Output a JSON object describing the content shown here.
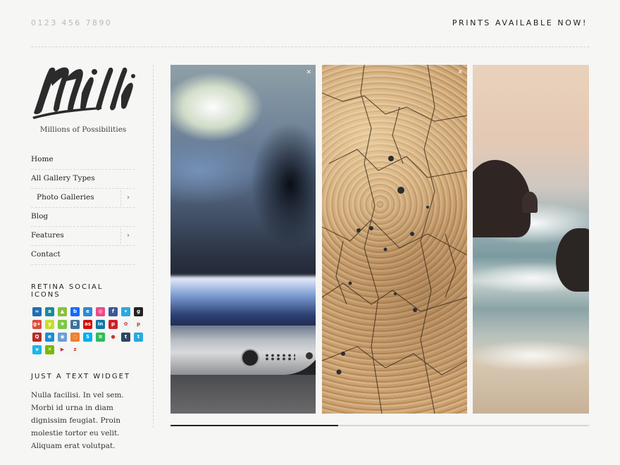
{
  "header": {
    "phone": "0123 456 7890",
    "promo": "PRINTS AVAILABLE NOW!"
  },
  "site": {
    "logo_text": "Milli",
    "tagline": "Millions of Possibilities"
  },
  "menu": [
    {
      "label": "Home",
      "has_arrow": false,
      "sub": false
    },
    {
      "label": "All Gallery Types",
      "has_arrow": false,
      "sub": false
    },
    {
      "label": "Photo Galleries",
      "has_arrow": true,
      "sub": true
    },
    {
      "label": "Blog",
      "has_arrow": false,
      "sub": false
    },
    {
      "label": "Features",
      "has_arrow": true,
      "sub": false
    },
    {
      "label": "Contact",
      "has_arrow": false,
      "sub": false
    }
  ],
  "menu_arrow": "›",
  "social": {
    "title": "RETINA SOCIAL ICONS",
    "icons": [
      {
        "name": "flickr",
        "color": "#1f6fb2",
        "glyph": "∞"
      },
      {
        "name": "amazon",
        "color": "#1a8a9a",
        "glyph": "a"
      },
      {
        "name": "android",
        "color": "#8bbf3b",
        "glyph": "▲"
      },
      {
        "name": "behance",
        "color": "#1769ff",
        "glyph": "b"
      },
      {
        "name": "bebo",
        "color": "#2a8ad8",
        "glyph": "e"
      },
      {
        "name": "dribbble",
        "color": "#ea4c89",
        "glyph": "◎"
      },
      {
        "name": "facebook",
        "color": "#3b5998",
        "glyph": "f"
      },
      {
        "name": "forrst",
        "color": "#2aa9e0",
        "glyph": "▾"
      },
      {
        "name": "github",
        "color": "#222222",
        "glyph": "g"
      },
      {
        "name": "google-plus",
        "color": "#dd4b39",
        "glyph": "g+"
      },
      {
        "name": "hacker-news",
        "color": "#c8dc2f",
        "glyph": "y"
      },
      {
        "name": "icq",
        "color": "#7ac943",
        "glyph": "❀"
      },
      {
        "name": "instagram",
        "color": "#3f729b",
        "glyph": "◘"
      },
      {
        "name": "lastfm",
        "color": "#d51007",
        "glyph": "as"
      },
      {
        "name": "linkedin",
        "color": "#0e76a8",
        "glyph": "in"
      },
      {
        "name": "pinterest",
        "color": "#cb2027",
        "glyph": "p"
      },
      {
        "name": "picasa",
        "color": "#f2f2f2",
        "glyph": "✿"
      },
      {
        "name": "pinterest-alt",
        "color": "#f4f4f4",
        "glyph": "p"
      },
      {
        "name": "quora",
        "color": "#b92b27",
        "glyph": "Q"
      },
      {
        "name": "rdio",
        "color": "#1b8fd2",
        "glyph": "e"
      },
      {
        "name": "reddit",
        "color": "#6aa0d8",
        "glyph": "◉"
      },
      {
        "name": "rss",
        "color": "#ee802f",
        "glyph": "◌"
      },
      {
        "name": "skype",
        "color": "#00aff0",
        "glyph": "S"
      },
      {
        "name": "spotify",
        "color": "#2ebd59",
        "glyph": "≋"
      },
      {
        "name": "stumbleupon",
        "color": "#f4f4f4",
        "glyph": "●"
      },
      {
        "name": "tumblr",
        "color": "#2c4762",
        "glyph": "t"
      },
      {
        "name": "twitter",
        "color": "#28a9e0",
        "glyph": "t"
      },
      {
        "name": "vimeo",
        "color": "#1ab7ea",
        "glyph": "v"
      },
      {
        "name": "xing",
        "color": "#7ab800",
        "glyph": "✕"
      },
      {
        "name": "youtube",
        "color": "#f4f4f4",
        "glyph": "▶"
      },
      {
        "name": "zerply",
        "color": "#f4f4f4",
        "glyph": "z"
      }
    ]
  },
  "text_widget": {
    "title": "JUST A TEXT WIDGET",
    "body": "Nulla facilisi. In vel sem. Morbi id urna in diam dignissim feugiat. Proin molestie tortor eu velit. Aliquam erat volutpat."
  },
  "gallery": {
    "close_glyph": "✕",
    "panels": [
      "phone-closeup",
      "cracked-earth",
      "sea-rocks"
    ],
    "progress": 0.4
  },
  "colors": {
    "background": "#f6f6f5",
    "text": "#333333",
    "muted": "#b9b9b9",
    "progress_track": "#d6d6d6",
    "progress_fill": "#222222"
  }
}
